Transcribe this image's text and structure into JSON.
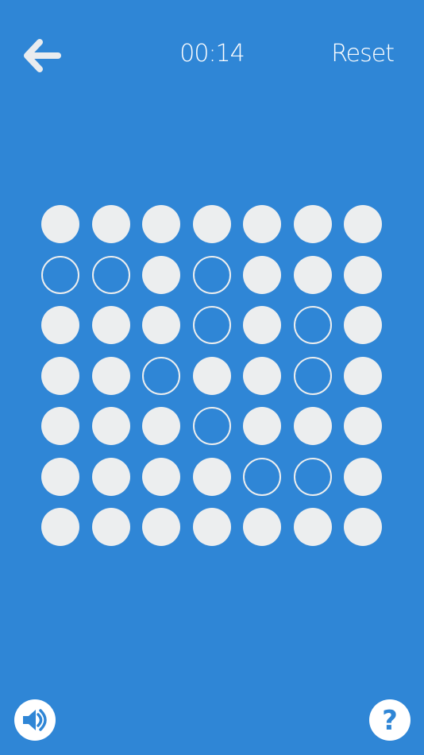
{
  "header": {
    "timer": "00:14",
    "reset_label": "Reset",
    "back_icon": "arrow-left-icon"
  },
  "board": {
    "rows": 7,
    "cols": 7,
    "cells": [
      [
        1,
        1,
        1,
        1,
        1,
        1,
        1
      ],
      [
        0,
        0,
        1,
        0,
        1,
        1,
        1
      ],
      [
        1,
        1,
        1,
        0,
        1,
        0,
        1
      ],
      [
        1,
        1,
        0,
        1,
        1,
        0,
        1
      ],
      [
        1,
        1,
        1,
        0,
        1,
        1,
        1
      ],
      [
        1,
        1,
        1,
        1,
        0,
        0,
        1
      ],
      [
        1,
        1,
        1,
        1,
        1,
        1,
        1
      ]
    ]
  },
  "footer": {
    "sound_icon": "speaker-icon",
    "help_icon": "question-mark-icon",
    "help_glyph": "?"
  },
  "colors": {
    "background": "#2f86d6",
    "peg": "#eceeef",
    "icon": "#ffffff"
  }
}
